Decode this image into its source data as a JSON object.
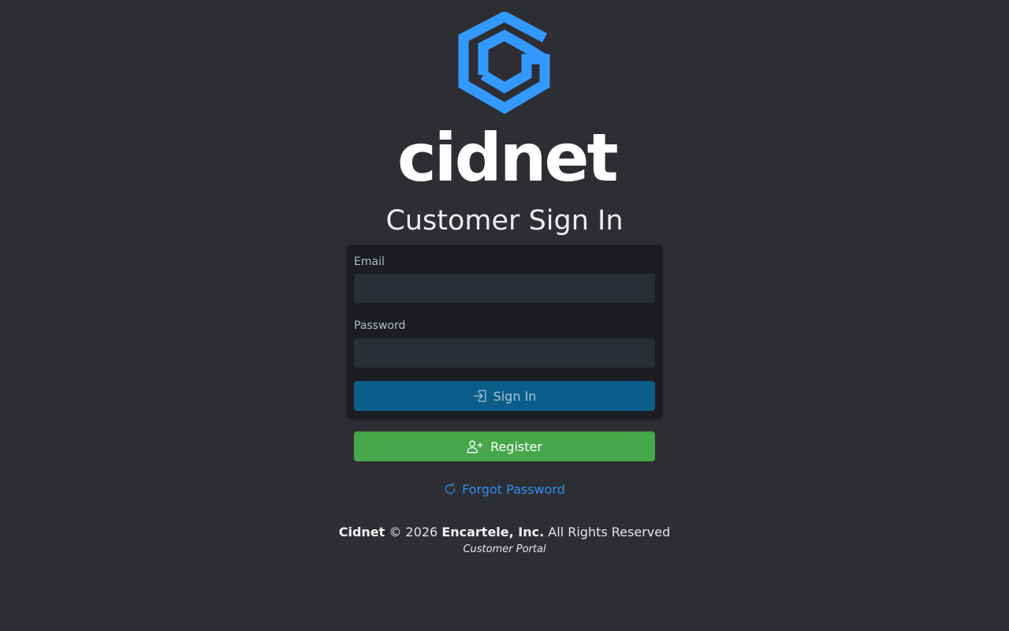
{
  "brand": {
    "name": "cidnet",
    "logo_icon": "hexagon-c-logo-icon",
    "accent_color": "#3399ff"
  },
  "page": {
    "title": "Customer Sign In"
  },
  "form": {
    "email_label": "Email",
    "email_value": "",
    "password_label": "Password",
    "password_value": "",
    "signin_label": "Sign In",
    "signin_icon": "sign-in-icon",
    "signin_color": "#0b5e8a"
  },
  "register": {
    "label": "Register",
    "icon": "person-plus-icon",
    "color": "#46a64a"
  },
  "forgot": {
    "label": "Forgot Password",
    "icon": "refresh-icon",
    "color": "#2d8ef0"
  },
  "footer": {
    "app_name": "Cidnet",
    "copyright": "© 2026",
    "company": "Encartele, Inc.",
    "rights": "All Rights Reserved",
    "subtitle": "Customer Portal"
  }
}
